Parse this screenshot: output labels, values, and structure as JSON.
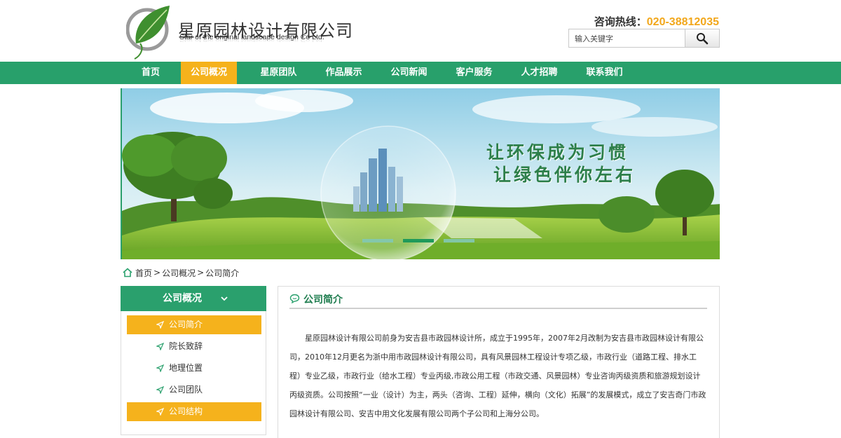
{
  "header": {
    "company_cn": "星原园林设计有限公司",
    "company_en": "Star of the original landscape design Co Ltd.",
    "hotline_label": "咨询热线：",
    "hotline_number": "020-38812035",
    "search_placeholder": "输入关键字",
    "search_icon": "search-icon"
  },
  "nav": {
    "items": [
      {
        "label": "首页"
      },
      {
        "label": "公司概况",
        "active": true
      },
      {
        "label": "星原团队"
      },
      {
        "label": "作品展示"
      },
      {
        "label": "公司新闻"
      },
      {
        "label": "客户服务"
      },
      {
        "label": "人才招聘"
      },
      {
        "label": "联系我们"
      }
    ]
  },
  "banner": {
    "slogan_line1": "让环保成为习惯",
    "slogan_line2": "让绿色伴你左右",
    "slides": 3,
    "active_slide": 2
  },
  "breadcrumb": {
    "home": "首页",
    "sep": ">",
    "level1": "公司概况",
    "level2": "公司简介"
  },
  "sidebar": {
    "title": "公司概况",
    "items": [
      {
        "label": "公司简介",
        "highlighted": true
      },
      {
        "label": "院长致辞"
      },
      {
        "label": "地理位置"
      },
      {
        "label": "公司团队"
      },
      {
        "label": "公司结构",
        "highlighted": true
      }
    ]
  },
  "main": {
    "title": "公司简介",
    "body": "星原园林设计有限公司前身为安吉县市政园林设计所，成立于1995年，2007年2月改制为安吉县市政园林设计有限公司，2010年12月更名为浙中用市政园林设计有限公司，具有风景园林工程设计专项乙级，市政行业（道路工程、排水工程）专业乙级，市政行业（给水工程）专业丙级,市政公用工程（市政交通、风景园林）专业咨询丙级资质和旅游规划设计丙级资质。公司按照“一业（设计）为主，两头（咨询、工程）延伸，横向（文化）拓展”的发展模式，成立了安吉奇门市政园林设计有限公司、安吉中用文化发展有限公司两个子公司和上海分公司。"
  },
  "colors": {
    "brand_green": "#28a06b",
    "accent_orange": "#f5b21c",
    "hotline_orange": "#f2a71b",
    "title_green": "#1f7d4f"
  }
}
